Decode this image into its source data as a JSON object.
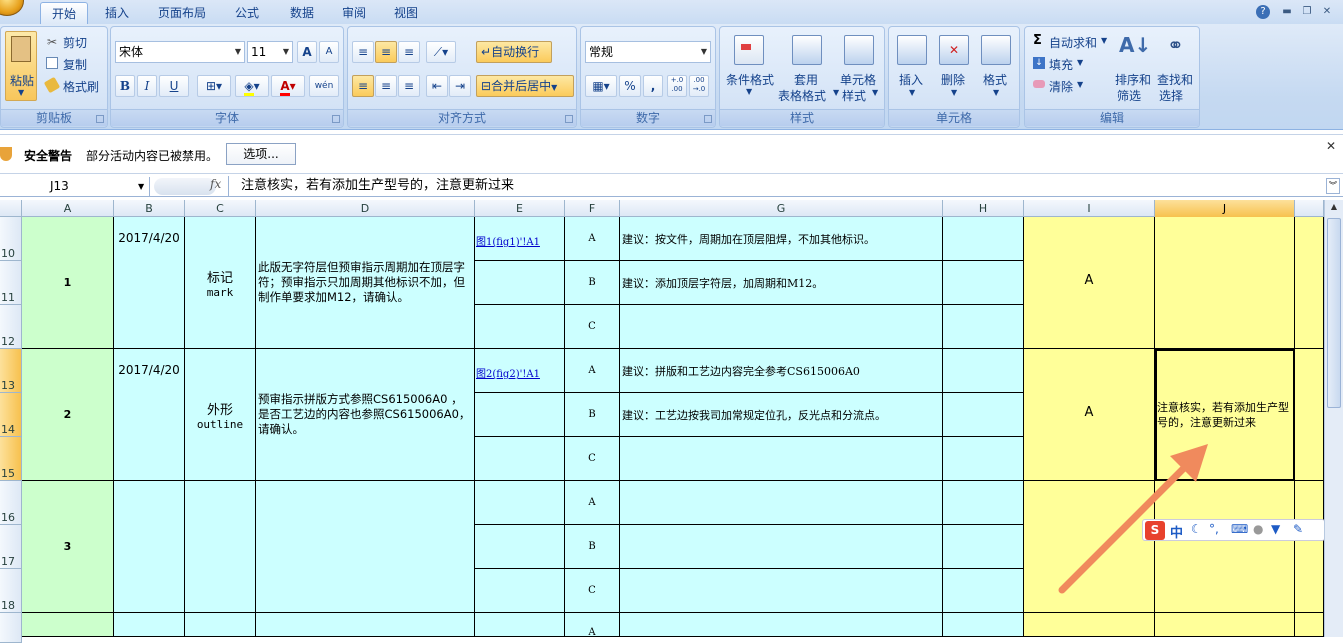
{
  "tabs": [
    "开始",
    "插入",
    "页面布局",
    "公式",
    "数据",
    "审阅",
    "视图"
  ],
  "clipboard": {
    "paste": "粘贴",
    "cut": "剪切",
    "copy": "复制",
    "format_painter": "格式刷",
    "label": "剪贴板"
  },
  "font": {
    "name": "宋体",
    "size": "11",
    "bold": "B",
    "italic": "I",
    "underline": "U",
    "label": "字体",
    "grow": "A",
    "shrink": "A",
    "color_a": "A",
    "phonetic": "wén"
  },
  "alignment": {
    "wrap": "自动换行",
    "merge": "合并后居中",
    "label": "对齐方式"
  },
  "number": {
    "format": "常规",
    "percent": "%",
    "comma": ",",
    "label": "数字"
  },
  "styles": {
    "cond": "条件格式",
    "table_line1": "套用",
    "table_line2": "表格格式",
    "cell_line1": "单元格",
    "cell_line2": "样式",
    "label": "样式"
  },
  "cells": {
    "insert": "插入",
    "delete": "删除",
    "format": "格式",
    "label": "单元格"
  },
  "editing": {
    "autosum": "自动求和",
    "fill": "填充",
    "clear": "清除",
    "sort_line1": "排序和",
    "sort_line2": "筛选",
    "find_line1": "查找和",
    "find_line2": "选择",
    "label": "编辑"
  },
  "security": {
    "title": "安全警告",
    "message": "部分活动内容已被禁用。",
    "options": "选项..."
  },
  "formula_bar": {
    "name_box": "J13",
    "fx": "fx",
    "content": "注意核实，若有添加生产型号的，注意更新过来"
  },
  "columns": [
    "A",
    "B",
    "C",
    "D",
    "E",
    "F",
    "G",
    "H",
    "I",
    "J"
  ],
  "rows": [
    "10",
    "11",
    "12",
    "13",
    "14",
    "15",
    "16",
    "17",
    "18"
  ],
  "records": [
    {
      "no": "1",
      "date": "2017/4/20",
      "item_cn": "标记",
      "item_en": "mark",
      "desc": "此版无字符层但预审指示周期加在顶层字符；预审指示只加周期其他标识不加，但制作单要求加M12，请确认。",
      "link": "图1(fig1)'!A1",
      "subs": [
        {
          "k": "A",
          "s": "建议：按文件，周期加在顶层阻焊，不加其他标识。"
        },
        {
          "k": "B",
          "s": "建议：添加顶层字符层，加周期和M12。"
        },
        {
          "k": "C",
          "s": ""
        }
      ],
      "result": "A",
      "note": ""
    },
    {
      "no": "2",
      "date": "2017/4/20",
      "item_cn": "外形",
      "item_en": "outline",
      "desc": "预审指示拼版方式参照CS615006A0 ，是否工艺边的内容也参照CS615006A0，请确认。",
      "link": "图2(fig2)'!A1",
      "subs": [
        {
          "k": "A",
          "s": "建议：拼版和工艺边内容完全参考CS615006A0"
        },
        {
          "k": "B",
          "s": "建议：工艺边按我司加常规定位孔，反光点和分流点。"
        },
        {
          "k": "C",
          "s": ""
        }
      ],
      "result": "A",
      "note": "注意核实，若有添加生产型号的，注意更新过来"
    },
    {
      "no": "3",
      "date": "",
      "item_cn": "",
      "item_en": "",
      "desc": "",
      "link": "",
      "subs": [
        {
          "k": "A",
          "s": ""
        },
        {
          "k": "B",
          "s": ""
        },
        {
          "k": "C",
          "s": ""
        }
      ],
      "result": "",
      "note": ""
    }
  ],
  "next_row_label": "A",
  "ime_toolbar": {
    "logo": "S",
    "lang": "中"
  },
  "colors": {
    "cyan": "#ccffff",
    "green": "#ccffcc",
    "yellow": "#ffff99",
    "arrow": "#f08a5d"
  }
}
